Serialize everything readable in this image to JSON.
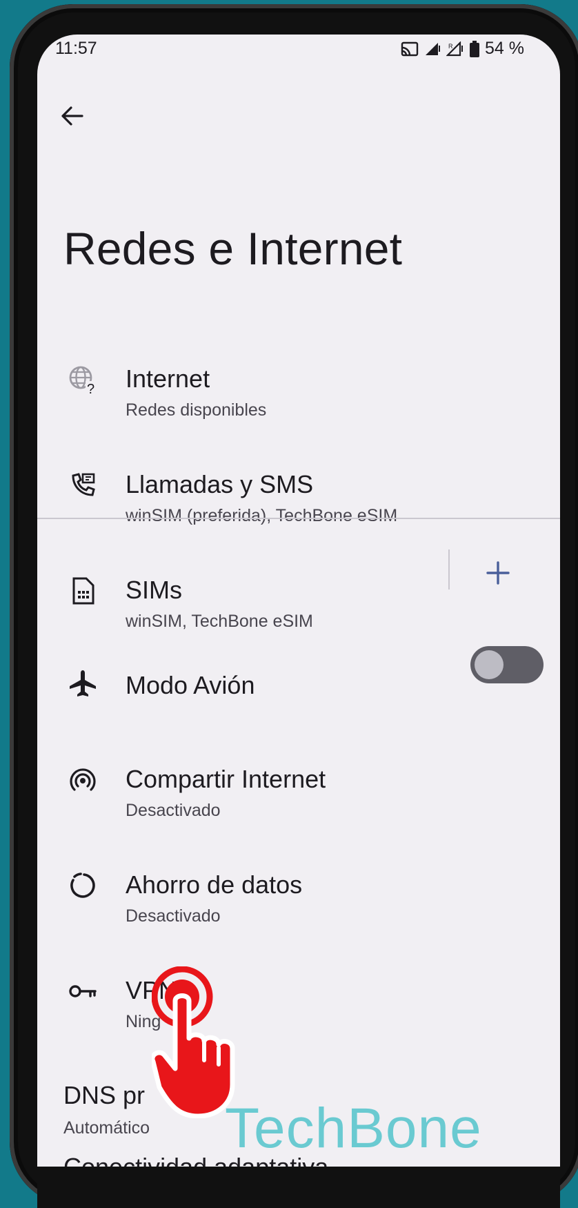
{
  "status": {
    "time": "11:57",
    "battery": "54 %"
  },
  "page": {
    "title": "Redes e Internet"
  },
  "items": [
    {
      "title": "Internet",
      "subtitle": "Redes disponibles",
      "icon": "globe-question-icon"
    },
    {
      "title": "Llamadas y SMS",
      "subtitle": "winSIM (preferida), TechBone eSIM",
      "icon": "phone-message-icon"
    },
    {
      "title": "SIMs",
      "subtitle": "winSIM, TechBone eSIM",
      "icon": "sim-card-icon"
    },
    {
      "title": "Modo Avión",
      "subtitle": "",
      "icon": "airplane-icon"
    },
    {
      "title": "Compartir Internet",
      "subtitle": "Desactivado",
      "icon": "hotspot-icon"
    },
    {
      "title": "Ahorro de datos",
      "subtitle": "Desactivado",
      "icon": "data-saver-icon"
    },
    {
      "title": "VPN",
      "subtitle": "Ning",
      "icon": "key-icon"
    },
    {
      "title": "DNS pr",
      "subtitle": "Automático",
      "icon": ""
    },
    {
      "title": "Conectividad adaptativa",
      "subtitle": "",
      "icon": ""
    }
  ],
  "airplane_toggle": {
    "state": "off"
  },
  "watermark": "TechBone",
  "colors": {
    "background": "#127a8a",
    "screen": "#f1eff3",
    "accent": "#4a5f9a",
    "pointer": "#e8161a"
  }
}
